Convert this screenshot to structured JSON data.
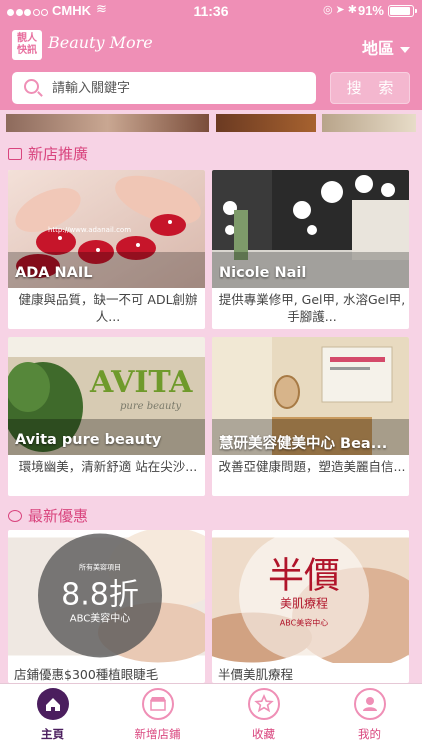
{
  "status_bar": {
    "carrier": "CMHK",
    "time": "11:36",
    "battery_percent": "91%"
  },
  "header": {
    "logo_text_line1": "靚人",
    "logo_text_line2": "快訊",
    "brand": "Beauty More",
    "region_label": "地區"
  },
  "search": {
    "placeholder": "請輸入關鍵字",
    "button_label": "搜 索"
  },
  "sections": {
    "new_shops_title": "新店推廣",
    "latest_offers_title": "最新優惠"
  },
  "new_shops": [
    {
      "name": "ADA NAIL",
      "desc": "健康與品質，缺一不可 ADL創辦人...",
      "image_watermark": "http://www.adanail.com"
    },
    {
      "name": "Nicole Nail",
      "desc": "提供專業修甲, Gel甲, 水溶Gel甲, 手腳護..."
    },
    {
      "name": "Avita pure beauty",
      "desc": "環境幽美，清新舒適 站在尖沙...",
      "image_sign": "AVITA",
      "image_sign_sub": "pure beauty"
    },
    {
      "name": "慧研美容健美中心 Bea...",
      "desc": "改善亞健康問題，塑造美麗自信..."
    }
  ],
  "offers": [
    {
      "overlay_small": "所有美容項目",
      "overlay_big": "8.8折",
      "overlay_shop": "ABC美容中心",
      "desc": "店鋪優惠$300種植眼睫毛"
    },
    {
      "overlay_big": "半價",
      "overlay_sub": "美肌療程",
      "overlay_shop": "ABC美容中心",
      "desc": "半價美肌療程"
    }
  ],
  "bottom_nav": [
    {
      "label": "主頁",
      "icon": "home-icon",
      "active": true
    },
    {
      "label": "新增店鋪",
      "icon": "shop-icon",
      "active": false
    },
    {
      "label": "收藏",
      "icon": "star-icon",
      "active": false
    },
    {
      "label": "我的",
      "icon": "user-icon",
      "active": false
    }
  ],
  "colors": {
    "header_pink": "#ef8fb6",
    "background_pink": "#f7d3e5",
    "accent": "#d9457e",
    "nav_active": "#4b1e5e"
  }
}
